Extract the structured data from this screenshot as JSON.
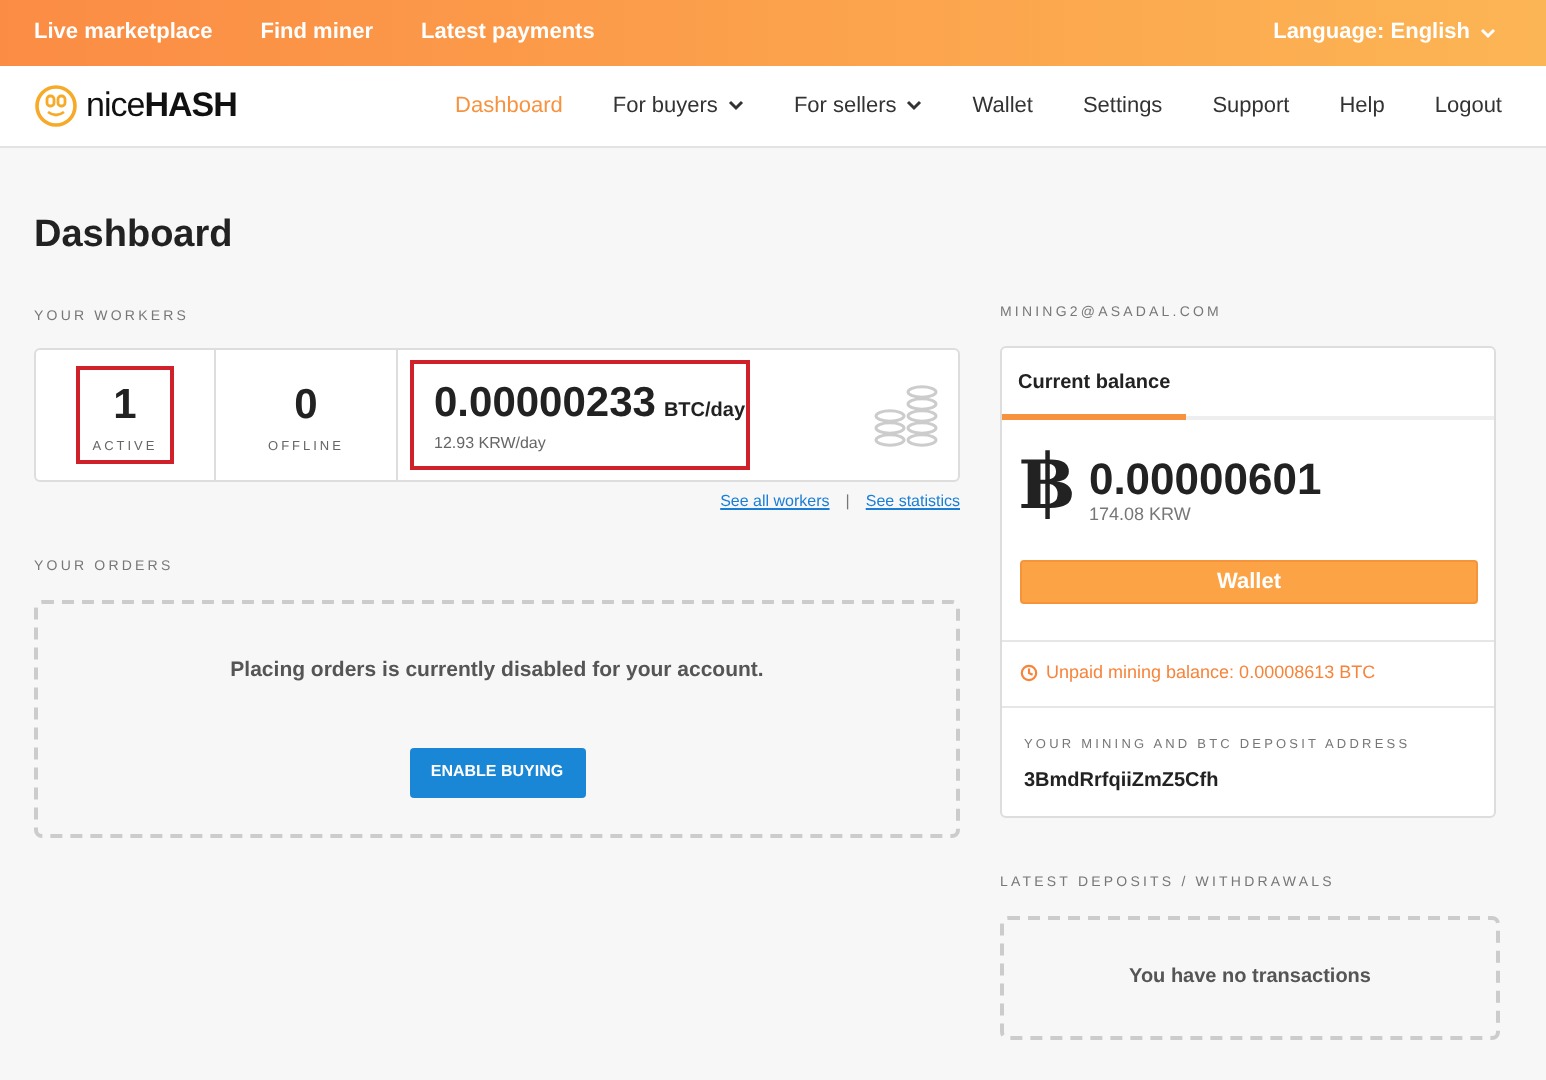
{
  "top_bar": {
    "links": [
      "Live marketplace",
      "Find miner",
      "Latest payments"
    ],
    "language": "Language: English"
  },
  "logo": {
    "light": "nice",
    "bold": "HASH"
  },
  "nav": [
    {
      "label": "Dashboard",
      "selected": true,
      "dropdown": false
    },
    {
      "label": "For buyers",
      "selected": false,
      "dropdown": true
    },
    {
      "label": "For sellers",
      "selected": false,
      "dropdown": true
    },
    {
      "label": "Wallet",
      "selected": false,
      "dropdown": false
    },
    {
      "label": "Settings",
      "selected": false,
      "dropdown": false
    },
    {
      "label": "Support",
      "selected": false,
      "dropdown": false
    },
    {
      "label": "Help",
      "selected": false,
      "dropdown": false
    },
    {
      "label": "Logout",
      "selected": false,
      "dropdown": false
    }
  ],
  "page_title": "Dashboard",
  "workers": {
    "heading": "YOUR WORKERS",
    "stats": [
      {
        "value": "1",
        "label": "ACTIVE",
        "highlighted": true
      },
      {
        "value": "0",
        "label": "OFFLINE",
        "highlighted": false
      }
    ],
    "rate": {
      "value": "0.00000233",
      "unit": "BTC/day",
      "secondary": "12.93 KRW/day",
      "highlighted": true
    },
    "links": [
      "See all workers",
      "See statistics"
    ],
    "separator": "|"
  },
  "orders": {
    "heading": "YOUR ORDERS",
    "message": "Placing orders is currently disabled for your account.",
    "button": "ENABLE BUYING"
  },
  "account": {
    "email": "MINING2@ASADAL.COM",
    "tab": "Current balance",
    "currency_symbol": "฿",
    "balance": "0.00000601",
    "balance_fiat": "174.08 KRW",
    "button": "Wallet",
    "unpaid": "Unpaid mining balance: 0.00008613 BTC",
    "address_label": "YOUR MINING AND BTC DEPOSIT ADDRESS",
    "address": "3BmdRrfqiiZmZ5Cfh"
  },
  "transactions": {
    "heading": "LATEST DEPOSITS / WITHDRAWALS",
    "message": "You have no transactions"
  }
}
